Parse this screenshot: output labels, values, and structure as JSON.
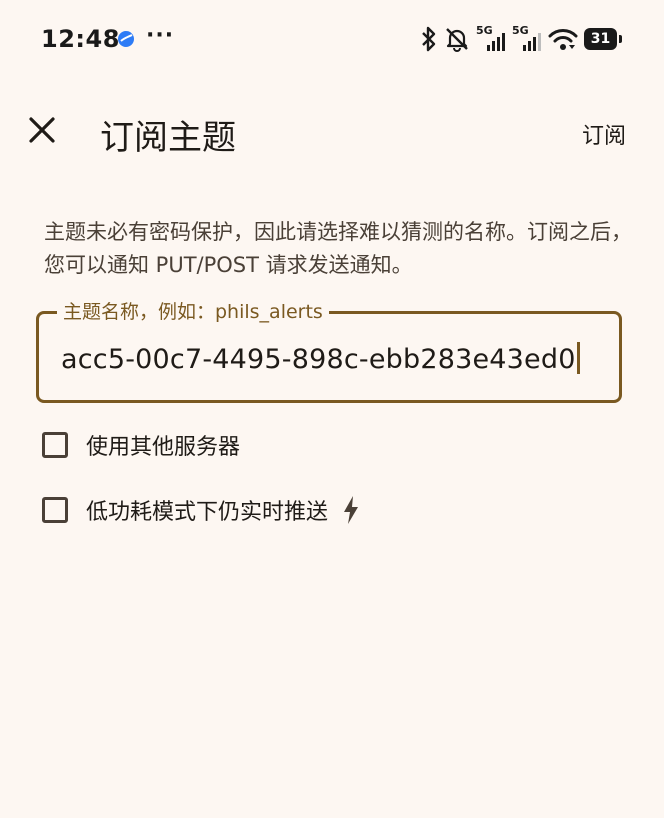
{
  "status_bar": {
    "time": "12:48",
    "more": "···",
    "signal_1_label": "5G",
    "signal_2_label": "5G",
    "battery_level": "31"
  },
  "app_bar": {
    "title": "订阅主题",
    "action_label": "订阅"
  },
  "description": "主题未必有密码保护，因此请选择难以猜测的名称。订阅之后，您可以通知 PUT/POST 请求发送通知。",
  "topic_field": {
    "label": "主题名称，例如：phils_alerts",
    "value": "acc5-00c7-4495-898c-ebb283e43ed0"
  },
  "options": {
    "other_server_label": "使用其他服务器",
    "other_server_checked": false,
    "instant_delivery_label": "低功耗模式下仍实时推送",
    "instant_delivery_checked": false
  },
  "colors": {
    "background": "#fdf7f2",
    "accent": "#7a5921",
    "text": "#1f1b17"
  }
}
